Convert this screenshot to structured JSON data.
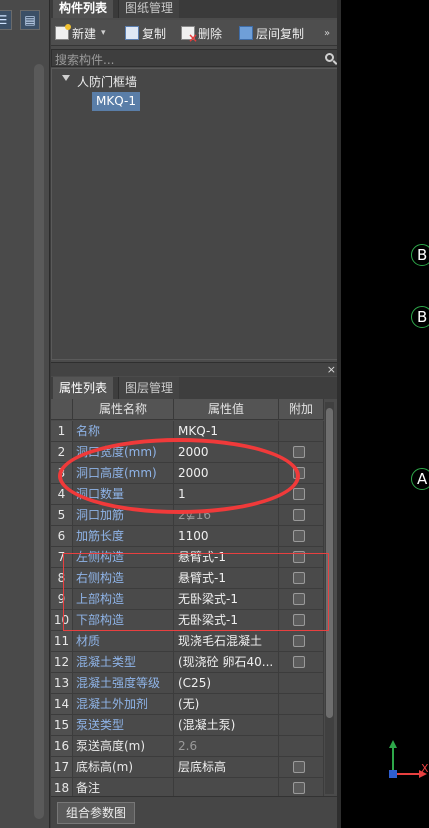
{
  "top_tabs": [
    "构件列表",
    "图纸管理"
  ],
  "toolbar": [
    {
      "label": "新建",
      "icon": "new-icon"
    },
    {
      "label": "复制",
      "icon": "copy-icon"
    },
    {
      "label": "删除",
      "icon": "delete-icon"
    },
    {
      "label": "层间复制",
      "icon": "floor-copy-icon"
    }
  ],
  "search": {
    "placeholder": "搜索构件..."
  },
  "tree": {
    "parent": "人防门框墙",
    "child": "MKQ-1"
  },
  "prop_tabs": [
    "属性列表",
    "图层管理"
  ],
  "table": {
    "headers": [
      "属性名称",
      "属性值",
      "附加"
    ],
    "rows": [
      {
        "num": "1",
        "name": "名称",
        "value": "MKQ-1",
        "check": false,
        "name_color": "blue"
      },
      {
        "num": "2",
        "name": "洞口宽度(mm)",
        "value": "2000",
        "check": true,
        "name_color": "blue"
      },
      {
        "num": "3",
        "name": "洞口高度(mm)",
        "value": "2000",
        "check": true,
        "name_color": "blue"
      },
      {
        "num": "4",
        "name": "洞口数量",
        "value": "1",
        "check": true,
        "name_color": "blue"
      },
      {
        "num": "5",
        "name": "洞口加筋",
        "value": "2⊈16",
        "check": true,
        "name_color": "blue",
        "value_gray": true
      },
      {
        "num": "6",
        "name": "加筋长度",
        "value": "1100",
        "check": true,
        "name_color": "blue"
      },
      {
        "num": "7",
        "name": "左侧构造",
        "value": "悬臂式-1",
        "check": true,
        "name_color": "blue"
      },
      {
        "num": "8",
        "name": "右侧构造",
        "value": "悬臂式-1",
        "check": true,
        "name_color": "blue"
      },
      {
        "num": "9",
        "name": "上部构造",
        "value": "无卧梁式-1",
        "check": true,
        "name_color": "blue"
      },
      {
        "num": "10",
        "name": "下部构造",
        "value": "无卧梁式-1",
        "check": true,
        "name_color": "blue"
      },
      {
        "num": "11",
        "name": "材质",
        "value": "现浇毛石混凝土",
        "check": true,
        "name_color": "blue"
      },
      {
        "num": "12",
        "name": "混凝土类型",
        "value": "(现浇砼 卵石40...",
        "check": true,
        "name_color": "blue"
      },
      {
        "num": "13",
        "name": "混凝土强度等级",
        "value": "(C25)",
        "check": false,
        "name_color": "blue"
      },
      {
        "num": "14",
        "name": "混凝土外加剂",
        "value": "(无)",
        "check": false,
        "name_color": "blue"
      },
      {
        "num": "15",
        "name": "泵送类型",
        "value": "(混凝土泵)",
        "check": false,
        "name_color": "blue"
      },
      {
        "num": "16",
        "name": "泵送高度(m)",
        "value": "2.6",
        "check": false,
        "name_color": "white",
        "value_gray": true
      },
      {
        "num": "17",
        "name": "底标高(m)",
        "value": "层底标高",
        "check": true,
        "name_color": "white"
      },
      {
        "num": "18",
        "name": "备注",
        "value": "",
        "check": true,
        "name_color": "white"
      }
    ]
  },
  "footer": {
    "button": "组合参数图"
  },
  "canvas": {
    "axis_labels": [
      "B",
      "B",
      "A"
    ],
    "y_axis": "Y",
    "x_axis": "X"
  },
  "colors": {
    "accent_red": "#f03a3a",
    "axis_green": "#2ea84a",
    "selection": "#5a7ea8",
    "label_blue": "#8fb4e8"
  }
}
